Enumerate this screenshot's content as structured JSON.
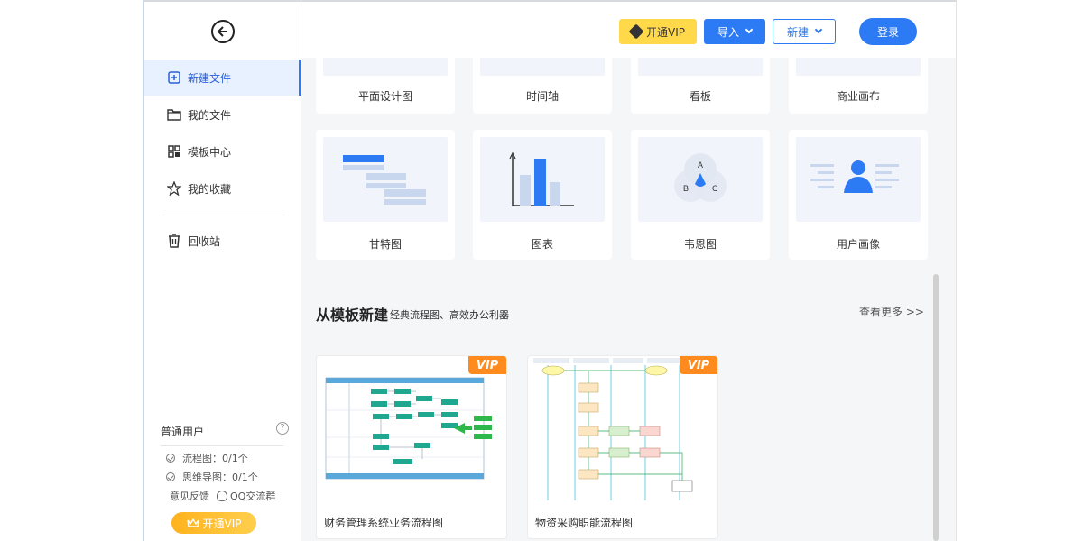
{
  "sidebar": {
    "items": [
      {
        "label": "新建文件",
        "icon": "new-file-icon",
        "active": true
      },
      {
        "label": "我的文件",
        "icon": "folder-icon"
      },
      {
        "label": "模板中心",
        "icon": "template-grid-icon"
      },
      {
        "label": "我的收藏",
        "icon": "star-icon"
      },
      {
        "label": "回收站",
        "icon": "trash-icon"
      }
    ],
    "user_type": "普通用户",
    "usage": [
      {
        "label": "流程图：0/1个"
      },
      {
        "label": "思维导图：0/1个"
      }
    ],
    "feedback": "意见反馈",
    "qq_group": "QQ交流群",
    "vip_button": "开通VIP"
  },
  "topbar": {
    "vip": "开通VIP",
    "import": "导入",
    "new": "新建",
    "login": "登录"
  },
  "diagram_types": {
    "row1": [
      "平面设计图",
      "时间轴",
      "看板",
      "商业画布"
    ],
    "row2": [
      "甘特图",
      "图表",
      "韦恩图",
      "用户画像"
    ]
  },
  "templates": {
    "title": "从模板新建",
    "subtitle": "经典流程图、高效办公利器",
    "more": "查看更多 >>",
    "items": [
      {
        "label": "财务管理系统业务流程图",
        "badge": "VIP"
      },
      {
        "label": "物资采购职能流程图",
        "badge": "VIP"
      }
    ]
  },
  "colors": {
    "accent": "#2d7bf4",
    "vip_yellow": "#ffd94a",
    "vip_orange": "#ff8a1d"
  }
}
